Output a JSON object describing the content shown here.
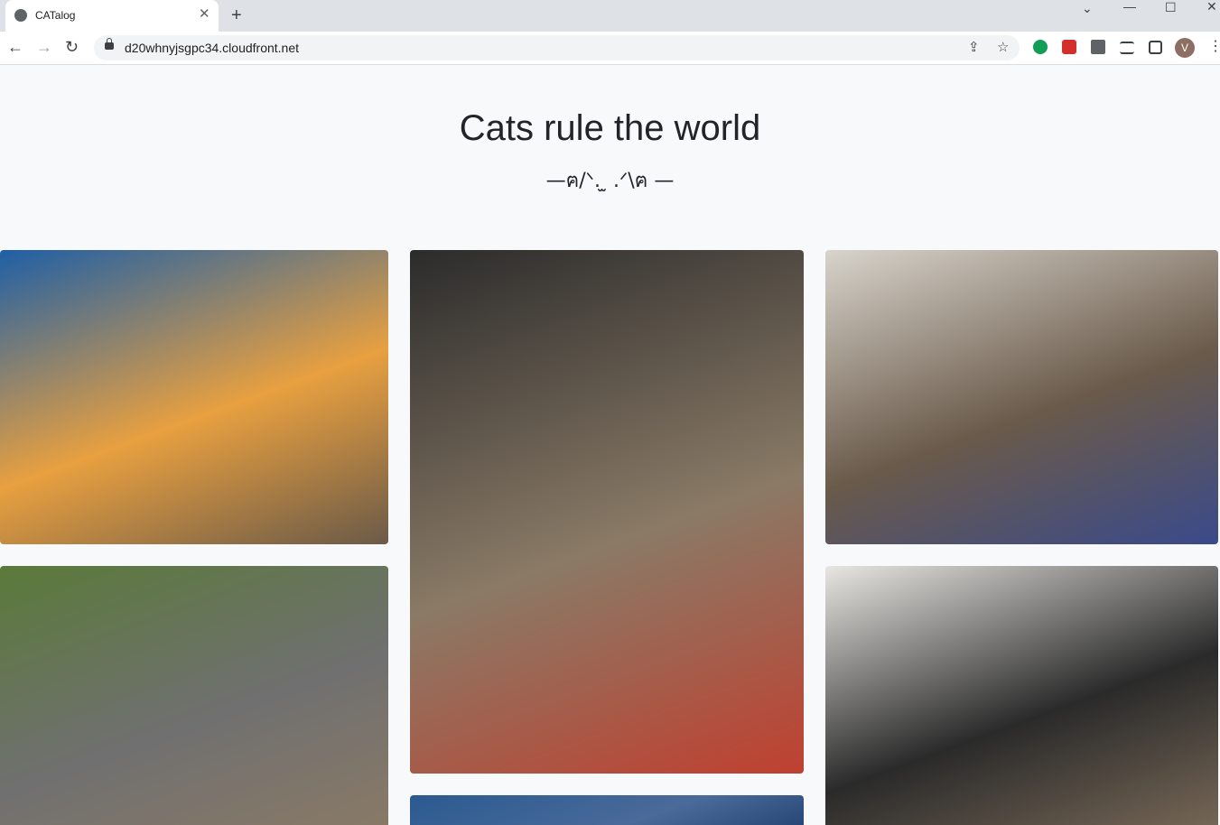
{
  "browser": {
    "tab_title": "CATalog",
    "tab_close": "✕",
    "new_tab": "+",
    "url": "d20whnyjsgpc34.cloudfront.net",
    "back": "←",
    "forward": "→",
    "reload": "↻",
    "share": "⇪",
    "star": "☆",
    "avatar_initial": "V",
    "window_controls": {
      "dropdown": "⌄",
      "minimize": "—",
      "maximize": "☐",
      "close": "✕"
    },
    "icons": [
      "globe-icon",
      "lock-icon",
      "android-icon",
      "password-icon",
      "puzzle-icon",
      "media-icon",
      "sidepanel-icon"
    ]
  },
  "page": {
    "title": "Cats rule the world",
    "subtitle": "—ฅ/ᐠ. ̫ .ᐟ\\ฅ —"
  },
  "gallery": {
    "photos": [
      {
        "name": "cat-photo-blue-wall",
        "alt": "cat lying on orange cushion",
        "colors": [
          "#1e5fa6",
          "#e8a040",
          "#6b5a48"
        ]
      },
      {
        "name": "cat-photo-chair-tongue",
        "alt": "cat sticking tongue out on chair",
        "colors": [
          "#2b2b2b",
          "#8a7a66",
          "#c04030"
        ]
      },
      {
        "name": "cat-photo-sleeping",
        "alt": "cat sleeping on bed",
        "colors": [
          "#d8d4cc",
          "#6a5a4a",
          "#3a4a8a"
        ]
      },
      {
        "name": "cat-photo-garden",
        "alt": "cat in carrier in garden",
        "colors": [
          "#5a7a3a",
          "#707070",
          "#8a7a66"
        ]
      },
      {
        "name": "cat-photo-chair-mesh",
        "alt": "cat behind mesh chair",
        "colors": [
          "#e8e6e2",
          "#2a2a2a",
          "#7a6a58"
        ]
      },
      {
        "name": "cat-photo-partial",
        "alt": "partially visible photo",
        "colors": [
          "#2a5a90",
          "#4a6a9a",
          "#1a3a6a"
        ]
      }
    ]
  }
}
